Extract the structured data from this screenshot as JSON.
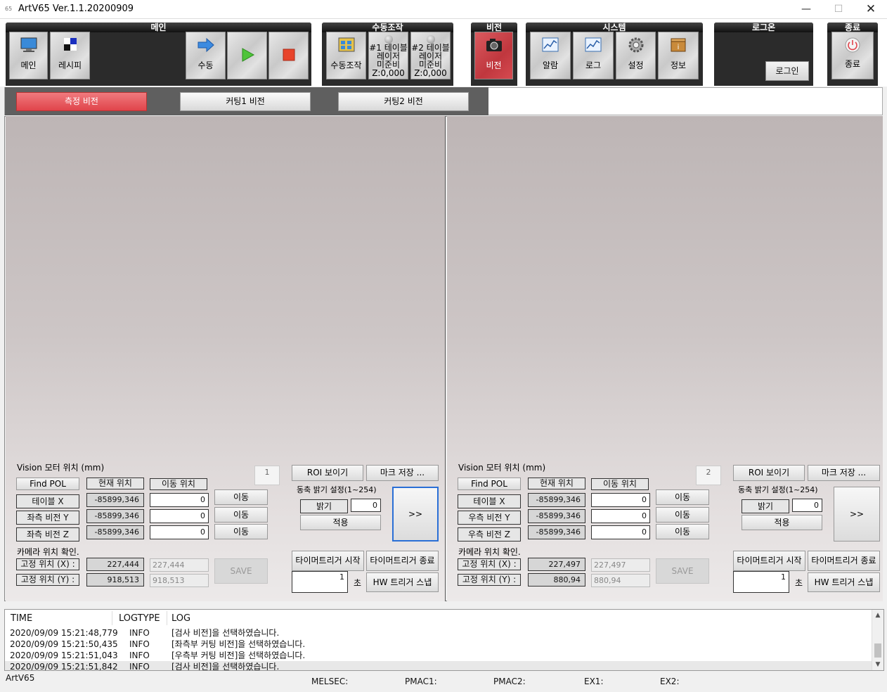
{
  "window": {
    "title": "ArtV65 Ver.1.1.20200909",
    "app_icon_text": "65"
  },
  "toolbar": {
    "groups": {
      "main": "메인",
      "manual": "수동조작",
      "vision": "비전",
      "system": "시스템",
      "logon": "로그온",
      "exit": "종료"
    },
    "buttons": {
      "main": "메인",
      "recipe": "레시피",
      "manual": "수동",
      "manual_op": "수동조작",
      "table1_l1": "#1 테이블",
      "table1_l2": "레이저",
      "table1_l3": "미준비",
      "table1_l4": "Z:0,000",
      "table2_l1": "#2 테이블",
      "table2_l2": "레이저",
      "table2_l3": "미준비",
      "table2_l4": "Z:0,000",
      "vision": "비전",
      "alarm": "알람",
      "log": "로그",
      "settings": "설정",
      "info": "정보",
      "login": "로그인",
      "exit": "종료"
    }
  },
  "tabs": [
    "측정 비전",
    "커팅1 비전",
    "커팅2 비전"
  ],
  "panels": {
    "left": {
      "id": "1",
      "motor_title": "Vision 모터 위치 (mm)",
      "find_pol": "Find POL",
      "hdr_current": "현재 위치",
      "hdr_move": "이동 위치",
      "axes": [
        {
          "label": "테이블 X",
          "current": "-85899,346",
          "move": "0",
          "btn": "이동"
        },
        {
          "label": "좌측 비전 Y",
          "current": "-85899,346",
          "move": "0",
          "btn": "이동"
        },
        {
          "label": "좌측 비전 Z",
          "current": "-85899,346",
          "move": "0",
          "btn": "이동"
        }
      ],
      "camera_title": "카메라 위치 확인.",
      "fixed": [
        {
          "label": "고정 위치 (X) :",
          "value": "227,444",
          "input": "227,444"
        },
        {
          "label": "고정 위치 (Y) :",
          "value": "918,513",
          "input": "918,513"
        }
      ],
      "save": "SAVE",
      "roi": "ROI 보이기",
      "mark_save": "마크 저장 ...",
      "light_title": "동축 밝기 설정(1~254)",
      "brightness": "밝기",
      "brightness_value": "0",
      "apply": "적용",
      "expand": ">>",
      "timer_start": "타이머트리거 시작",
      "timer_stop": "타이머트리거 종료",
      "timer_value": "1",
      "sec": "초",
      "hw_snap": "HW 트리거 스냅"
    },
    "right": {
      "id": "2",
      "motor_title": "Vision 모터 위치 (mm)",
      "find_pol": "Find POL",
      "hdr_current": "현재 위치",
      "hdr_move": "이동 위치",
      "axes": [
        {
          "label": "테이블 X",
          "current": "-85899,346",
          "move": "0",
          "btn": "이동"
        },
        {
          "label": "우측 비전 Y",
          "current": "-85899,346",
          "move": "0",
          "btn": "이동"
        },
        {
          "label": "우측 비전 Z",
          "current": "-85899,346",
          "move": "0",
          "btn": "이동"
        }
      ],
      "camera_title": "카메라 위치 확인.",
      "fixed": [
        {
          "label": "고정 위치 (X) :",
          "value": "227,497",
          "input": "227,497"
        },
        {
          "label": "고정 위치 (Y) :",
          "value": "880,94",
          "input": "880,94"
        }
      ],
      "save": "SAVE",
      "roi": "ROI 보이기",
      "mark_save": "마크 저장 ...",
      "light_title": "동축 밝기 설정(1~254)",
      "brightness": "밝기",
      "brightness_value": "0",
      "apply": "적용",
      "expand": ">>",
      "timer_start": "타이머트리거 시작",
      "timer_stop": "타이머트리거 종료",
      "timer_value": "1",
      "sec": "초",
      "hw_snap": "HW 트리거 스냅"
    }
  },
  "log": {
    "headers": [
      "TIME",
      "LOGTYPE",
      "LOG"
    ],
    "rows": [
      [
        "2020/09/09 15:21:48,779",
        "INFO",
        "[검사 비전]을 선택하였습니다."
      ],
      [
        "2020/09/09 15:21:50,435",
        "INFO",
        "[좌측부 커팅 비전]을 선택하였습니다."
      ],
      [
        "2020/09/09 15:21:51,043",
        "INFO",
        "[우측부 커팅 비전]을 선택하였습니다."
      ],
      [
        "2020/09/09 15:21:51,842",
        "INFO",
        "[검사 비전]을 선택하였습니다."
      ]
    ]
  },
  "status": {
    "app": "ArtV65",
    "melsec": "MELSEC:",
    "pmac1": "PMAC1:",
    "pmac2": "PMAC2:",
    "ex1": "EX1:",
    "ex2": "EX2:"
  },
  "colors": {
    "active_red": "#e0444b",
    "group_dark": "#2b2b2b"
  }
}
